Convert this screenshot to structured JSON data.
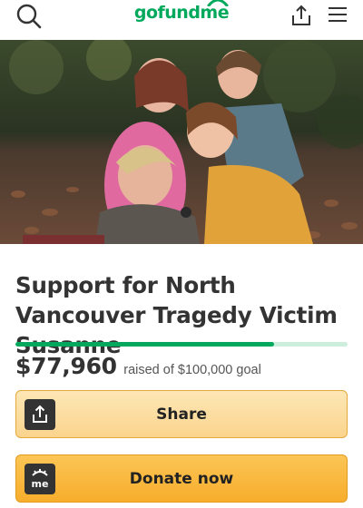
{
  "header": {
    "logo_text": "gofundme",
    "search_icon": "search-icon",
    "share_icon": "share-icon",
    "menu_icon": "hamburger-menu-icon"
  },
  "campaign": {
    "title": "Support for North Vancouver Tragedy Victim Susanne",
    "raised_amount": "$77,960",
    "raised_text": "raised of $100,000 goal",
    "progress_percent": 78
  },
  "buttons": {
    "share_label": "Share",
    "donate_label": "Donate now",
    "donate_icon_text": "me"
  },
  "colors": {
    "brand_green": "#02a95c",
    "progress_track": "#cdeedd",
    "share_button": "#fbd48e",
    "donate_button": "#f8ad2c"
  }
}
